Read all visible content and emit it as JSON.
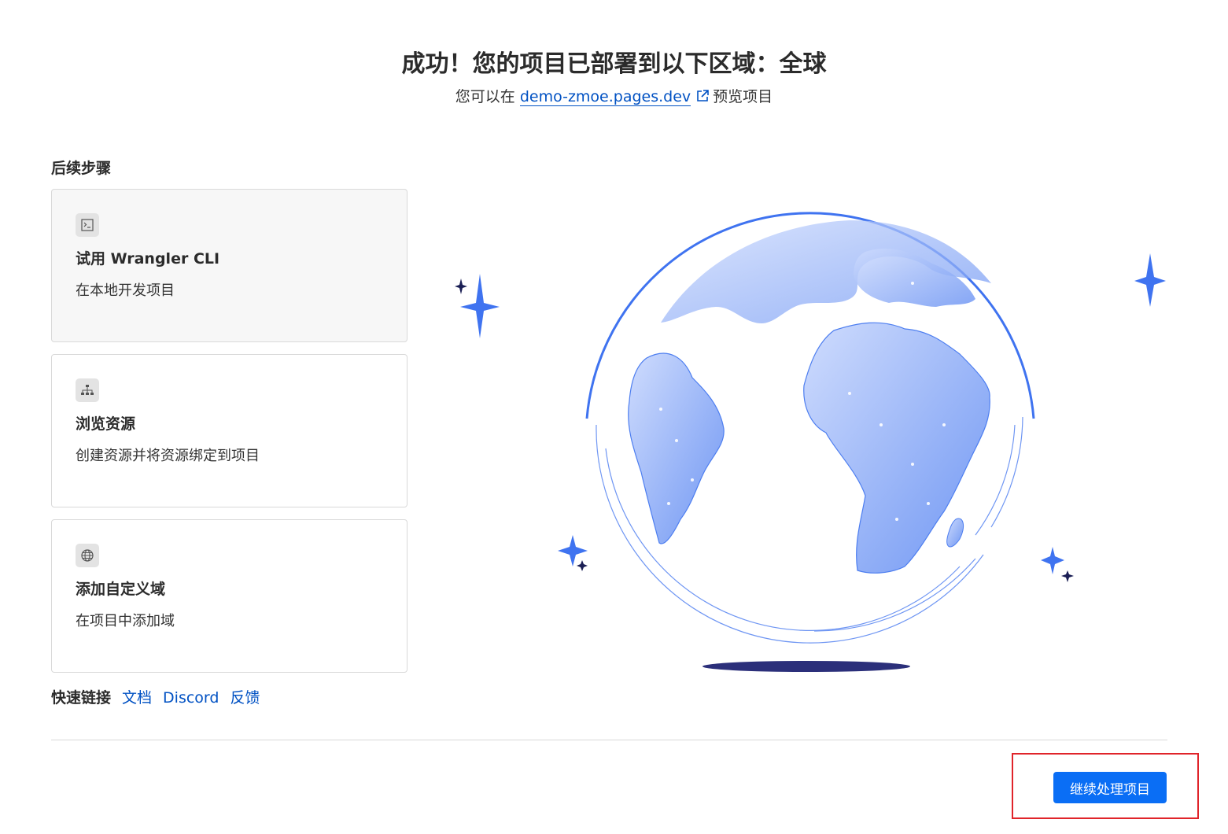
{
  "header": {
    "title": "成功！您的项目已部署到以下区域：全球",
    "subtitle_prefix": "您可以在",
    "preview_link": "demo-zmoe.pages.dev",
    "subtitle_suffix": "预览项目"
  },
  "next_steps": {
    "heading": "后续步骤",
    "cards": [
      {
        "icon": "terminal-icon",
        "title": "试用 Wrangler CLI",
        "description": "在本地开发项目"
      },
      {
        "icon": "sitemap-icon",
        "title": "浏览资源",
        "description": "创建资源并将资源绑定到项目"
      },
      {
        "icon": "globe-icon",
        "title": "添加自定义域",
        "description": "在项目中添加域"
      }
    ]
  },
  "quick_links": {
    "label": "快速链接",
    "links": [
      "文档",
      "Discord",
      "反馈"
    ]
  },
  "footer": {
    "continue_button": "继续处理项目"
  },
  "colors": {
    "accent": "#0a6ef5",
    "link": "#0051c3",
    "globe_blue": "#3f73f0",
    "globe_light": "#a9c2fb",
    "highlight_border": "#e0242a"
  }
}
